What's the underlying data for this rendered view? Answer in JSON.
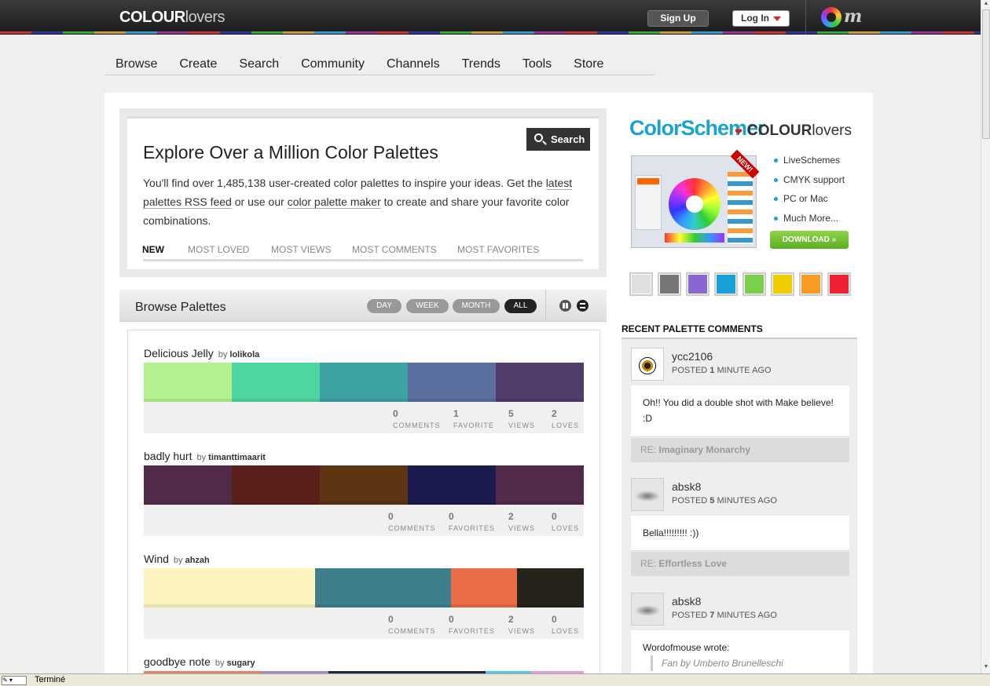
{
  "header": {
    "logo": {
      "part1": "COLOUR",
      "part2": "lovers"
    },
    "signup_label": "Sign Up",
    "login_label": "Log In",
    "om_label": "m"
  },
  "nav": [
    "Browse",
    "Create",
    "Search",
    "Community",
    "Channels",
    "Trends",
    "Tools",
    "Store"
  ],
  "explore": {
    "title": "Explore Over a Million Color Palettes",
    "search_label": "Search",
    "desc": {
      "t1": "You'll find over 1,485,138 user-created color palettes to inspire your ideas. Get the ",
      "link1": "latest palettes RSS feed",
      "t2": " or use our ",
      "link2": "color palette maker",
      "t3": " to create and share your favorite color combinations."
    },
    "tabs": [
      "NEW",
      "MOST LOVED",
      "MOST VIEWS",
      "MOST COMMENTS",
      "MOST FAVORITES"
    ]
  },
  "browse": {
    "title": "Browse Palettes",
    "filters": [
      "DAY",
      "WEEK",
      "MONTH",
      "ALL"
    ],
    "view_icons": [
      "grid-view-icon",
      "list-view-icon"
    ],
    "palettes": [
      {
        "name": "Delicious Jelly",
        "by": "by",
        "author": "lolikola",
        "colors": [
          "#b3f28f",
          "#4fd59f",
          "#3ea1a2",
          "#5a6f9d",
          "#523c6c"
        ],
        "widths": [
          1,
          1,
          1,
          1,
          1
        ],
        "stats": [
          {
            "n": "0",
            "l": "COMMENTS"
          },
          {
            "n": "1",
            "l": "FAVORITE"
          },
          {
            "n": "5",
            "l": "VIEWS"
          },
          {
            "n": "2",
            "l": "LOVES"
          }
        ]
      },
      {
        "name": "badly hurt",
        "by": "by",
        "author": "timanttimaarit",
        "colors": [
          "#512b48",
          "#5a1f1b",
          "#5d3512",
          "#1b1c4d",
          "#522a4a"
        ],
        "widths": [
          1,
          1,
          1,
          1,
          1
        ],
        "stats": [
          {
            "n": "0",
            "l": "COMMENTS"
          },
          {
            "n": "0",
            "l": "FAVORITES"
          },
          {
            "n": "2",
            "l": "VIEWS"
          },
          {
            "n": "0",
            "l": "LOVES"
          }
        ]
      },
      {
        "name": "Wind",
        "by": "by",
        "author": "ahzah",
        "colors": [
          "#fbf4c1",
          "#3e7f8b",
          "#e96e45",
          "#26241a"
        ],
        "widths": [
          218,
          173,
          84,
          85
        ],
        "stats": [
          {
            "n": "0",
            "l": "COMMENTS"
          },
          {
            "n": "0",
            "l": "FAVORITES"
          },
          {
            "n": "2",
            "l": "VIEWS"
          },
          {
            "n": "0",
            "l": "LOVES"
          }
        ]
      },
      {
        "name": "goodbye note",
        "by": "by",
        "author": "sugary",
        "colors": [
          "#e9806a",
          "#9b8cc5",
          "#1d2547",
          "#56c5e8",
          "#e49ae0"
        ],
        "widths": [
          150,
          85,
          200,
          58,
          67
        ],
        "stats": []
      }
    ]
  },
  "sidebar": {
    "promo": {
      "brand": "ColorSchemer",
      "heart": "❤",
      "partner": {
        "part1": "COLOUR",
        "part2": "lovers"
      },
      "badge": "NEW!",
      "features": [
        "LiveSchemes",
        "CMYK support",
        "PC or Mac",
        "Much More..."
      ],
      "download_label": "DOWNLOAD »"
    },
    "chips": [
      "#e0e0e0",
      "#777777",
      "#8a66d0",
      "#1aa0d8",
      "#7ad04a",
      "#f0cc00",
      "#f99a22",
      "#ee2233"
    ],
    "recent_title": "RECENT PALETTE COMMENTS",
    "comments": [
      {
        "user": "ycc2106",
        "posted": "POSTED",
        "num": "1",
        "ago": "MINUTE AGO",
        "text": "Oh!! You did a double shot with Make believe! :D",
        "re": "RE:",
        "palette": "Imaginary Monarchy"
      },
      {
        "user": "absk8",
        "posted": "POSTED",
        "num": "5",
        "ago": "MINUTES AGO",
        "text": "Bella!!!!!!!!! :))",
        "re": "RE:",
        "palette": "Effortless Love"
      },
      {
        "user": "absk8",
        "posted": "POSTED",
        "num": "7",
        "ago": "MINUTES AGO",
        "text": "Wordofmouse wrote:",
        "quote": "Fan by Umberto Brunelleschi"
      }
    ]
  },
  "status": {
    "text": "Terminé"
  },
  "colors": {
    "accent": "#1aa3cc",
    "topbar": "#222222",
    "download": "#6abf2c"
  }
}
